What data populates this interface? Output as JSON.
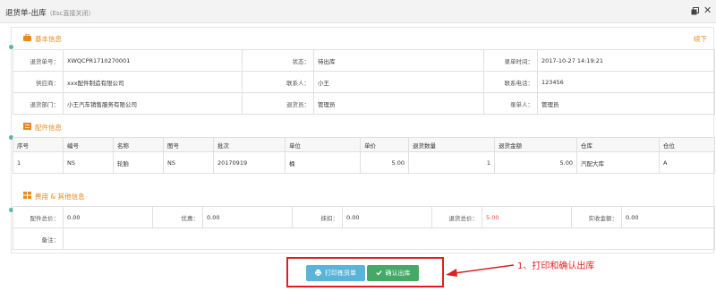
{
  "window": {
    "title": "退货单-出库",
    "hint": "（Esc直接关闭）",
    "restore_icon": "restore-icon",
    "close_icon": "close-icon",
    "close_glyph": "✕"
  },
  "basic": {
    "title": "基本信息",
    "action": "续下",
    "rows": [
      [
        {
          "k": "退货单号：",
          "v": "XWQCPR1710270001"
        },
        {
          "k": "状态：",
          "v": "待出库"
        },
        {
          "k": "录单时间：",
          "v": "2017-10-27 14:19:21"
        }
      ],
      [
        {
          "k": "供应商：",
          "v": "xxx配件制造有限公司"
        },
        {
          "k": "联系人：",
          "v": "小王"
        },
        {
          "k": "联系电话：",
          "v": "123456"
        }
      ],
      [
        {
          "k": "退货部门：",
          "v": "小王汽车销售服务有限公司"
        },
        {
          "k": "退货员：",
          "v": "管理员"
        },
        {
          "k": "录单人：",
          "v": "管理员"
        }
      ]
    ]
  },
  "parts": {
    "title": "配件信息",
    "columns": [
      "序号",
      "编号",
      "名称",
      "图号",
      "批次",
      "单位",
      "单价",
      "退货数量",
      "退货金额",
      "仓库",
      "仓位"
    ],
    "rows": [
      [
        "1",
        "NS",
        "轮胎",
        "NS",
        "20170919",
        "桶",
        "5.00",
        "1",
        "5.00",
        "汽配大库",
        "A"
      ]
    ]
  },
  "finance": {
    "title": "费用 & 其他信息",
    "row": [
      {
        "k": "配件总价：",
        "v": "0.00"
      },
      {
        "k": "优惠：",
        "v": "0.00"
      },
      {
        "k": "抹扣：",
        "v": "0.00"
      },
      {
        "k": "退货总价：",
        "v": "5.00",
        "highlight": true
      },
      {
        "k": "实收金额：",
        "v": "0.00"
      }
    ],
    "remark_label": "备注：",
    "remark_value": ""
  },
  "actions": {
    "print_label": "打印拣货单",
    "confirm_label": "确认出库",
    "print_icon": "printer-icon",
    "confirm_icon": "check-icon"
  },
  "annotation": "1、打印和确认出库",
  "colors": {
    "accent_orange": "#e8891d",
    "highlight_red": "#e84c3d",
    "print_button": "#5ab3d8",
    "confirm_button": "#45a867",
    "annotation_red": "#e02020"
  }
}
